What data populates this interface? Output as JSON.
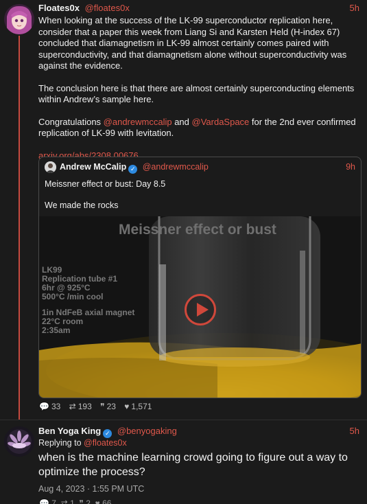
{
  "post": {
    "author_name": "Floates0x",
    "author_handle": "@floates0x",
    "time": "5h",
    "paragraphs": {
      "p1": "When looking at the success of the LK-99 superconductor replication here, consider that a paper this week from Liang Si and Karsten Held (H-index 67) concluded that diamagnetism in LK-99 almost certainly comes paired with superconductivity, and that diamagnetism alone without superconductivity was against the evidence.",
      "p2": "The conclusion here is that there are almost certainly superconducting elements within Andrew’s sample here.",
      "p3_prefix": "Congratulations ",
      "p3_mention1": "@andrewmccalip",
      "p3_mid": " and ",
      "p3_mention2": "@VardaSpace",
      "p3_suffix": " for the 2nd ever confirmed replication of LK-99 with levitation.",
      "link": "arxiv.org/abs/2308.00676"
    },
    "stats": {
      "replies": "33",
      "reposts": "193",
      "quotes": "23",
      "likes": "1,571"
    }
  },
  "quote": {
    "author_name": "Andrew McCalip",
    "author_handle": "@andrewmccalip",
    "time": "9h",
    "verified_glyph": "✓",
    "line1": "Meissner effect or bust: Day 8.5",
    "line2": "We made the rocks",
    "video": {
      "title": "Meissner effect or bust",
      "notes": [
        "LK99",
        "Replication tube #1",
        "6hr @ 925°C",
        "500°C /min cool",
        "",
        "1in NdFeB axial magnet",
        "22°C room",
        "2:35am"
      ]
    }
  },
  "reply": {
    "author_name": "Ben Yoga King",
    "author_handle": "@benyogaking",
    "time": "5h",
    "replying_prefix": "Replying to ",
    "replying_handle": "@floates0x",
    "text": "when is the machine learning crowd going to figure out a way to optimize the process?",
    "timestamp": "Aug 4, 2023 · 1:55 PM UTC",
    "stats_partial": {
      "replies": "7",
      "reposts": "1",
      "quotes": "2",
      "likes": "66"
    }
  },
  "icons": {
    "reply": "💬",
    "repost": "⇄",
    "quote": "❞",
    "like": "♥"
  },
  "colors": {
    "accent": "#e0584b",
    "background": "#1b1b1b",
    "verified": "#2d8ae0"
  }
}
